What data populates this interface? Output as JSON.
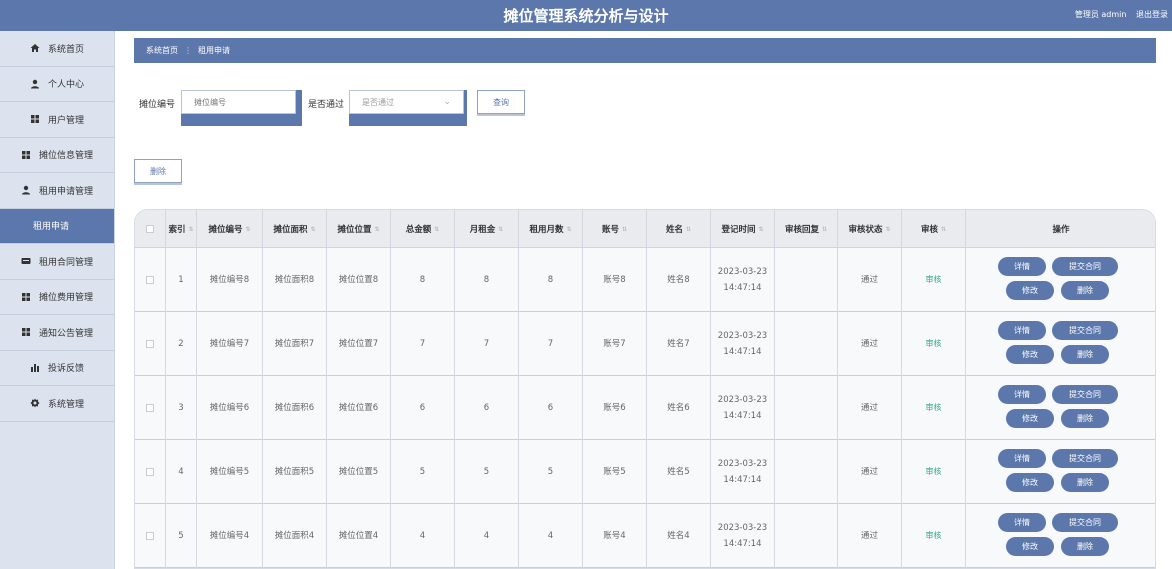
{
  "header": {
    "title": "摊位管理系统分析与设计",
    "user": "管理员 admin",
    "logout": "退出登录"
  },
  "sidebar": {
    "items": [
      {
        "label": "系统首页",
        "icon": "home-icon",
        "active": false,
        "sub": false
      },
      {
        "label": "个人中心",
        "icon": "user-icon",
        "active": false,
        "sub": false
      },
      {
        "label": "用户管理",
        "icon": "grid-icon",
        "active": false,
        "sub": false
      },
      {
        "label": "摊位信息管理",
        "icon": "grid-icon",
        "active": false,
        "sub": false
      },
      {
        "label": "租用申请管理",
        "icon": "user-icon",
        "active": false,
        "sub": false
      },
      {
        "label": "租用申请",
        "icon": "",
        "active": true,
        "sub": true
      },
      {
        "label": "租用合同管理",
        "icon": "contract-icon",
        "active": false,
        "sub": false
      },
      {
        "label": "摊位费用管理",
        "icon": "grid-icon",
        "active": false,
        "sub": false
      },
      {
        "label": "通知公告管理",
        "icon": "grid-icon",
        "active": false,
        "sub": false
      },
      {
        "label": "投诉反馈",
        "icon": "chart-icon",
        "active": false,
        "sub": false
      },
      {
        "label": "系统管理",
        "icon": "gear-icon",
        "active": false,
        "sub": false
      }
    ]
  },
  "breadcrumb": {
    "home": "系统首页",
    "sep": "⋮",
    "current": "租用申请"
  },
  "search": {
    "stall_no_label": "摊位编号",
    "stall_no_placeholder": "摊位编号",
    "approved_label": "是否通过",
    "approved_placeholder": "是否通过",
    "query_button": "查询"
  },
  "toolbar": {
    "delete_button": "删除"
  },
  "table": {
    "headers": [
      "索引",
      "摊位编号",
      "摊位面积",
      "摊位位置",
      "总金额",
      "月租金",
      "租用月数",
      "账号",
      "姓名",
      "登记时间",
      "审核回复",
      "审核状态",
      "审核",
      "操作"
    ],
    "rows": [
      {
        "idx": "1",
        "no": "摊位编号8",
        "area": "摊位面积8",
        "pos": "摊位位置8",
        "total": "8",
        "rent": "8",
        "months": "8",
        "account": "账号8",
        "name": "姓名8",
        "date": "2023-03-23",
        "time": "14:47:14",
        "reply": "",
        "status": "通过",
        "review": "审核"
      },
      {
        "idx": "2",
        "no": "摊位编号7",
        "area": "摊位面积7",
        "pos": "摊位位置7",
        "total": "7",
        "rent": "7",
        "months": "7",
        "account": "账号7",
        "name": "姓名7",
        "date": "2023-03-23",
        "time": "14:47:14",
        "reply": "",
        "status": "通过",
        "review": "审核"
      },
      {
        "idx": "3",
        "no": "摊位编号6",
        "area": "摊位面积6",
        "pos": "摊位位置6",
        "total": "6",
        "rent": "6",
        "months": "6",
        "account": "账号6",
        "name": "姓名6",
        "date": "2023-03-23",
        "time": "14:47:14",
        "reply": "",
        "status": "通过",
        "review": "审核"
      },
      {
        "idx": "4",
        "no": "摊位编号5",
        "area": "摊位面积5",
        "pos": "摊位位置5",
        "total": "5",
        "rent": "5",
        "months": "5",
        "account": "账号5",
        "name": "姓名5",
        "date": "2023-03-23",
        "time": "14:47:14",
        "reply": "",
        "status": "通过",
        "review": "审核"
      },
      {
        "idx": "5",
        "no": "摊位编号4",
        "area": "摊位面积4",
        "pos": "摊位位置4",
        "total": "4",
        "rent": "4",
        "months": "4",
        "account": "账号4",
        "name": "姓名4",
        "date": "2023-03-23",
        "time": "14:47:14",
        "reply": "",
        "status": "通过",
        "review": "审核"
      }
    ],
    "actions": {
      "detail": "详情",
      "submit_contract": "提交合同",
      "edit": "修改",
      "delete": "删除"
    }
  },
  "colors": {
    "primary": "#5c77ac",
    "sidebar_bg": "#dde3ee",
    "success_text": "#2eaa8a"
  }
}
